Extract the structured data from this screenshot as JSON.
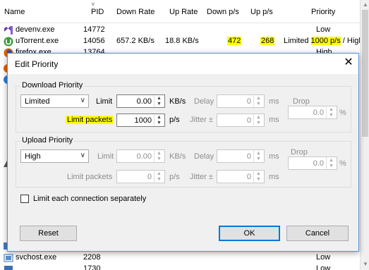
{
  "table": {
    "headers": {
      "name": "Name",
      "pid": "PID",
      "down_rate": "Down Rate",
      "up_rate": "Up Rate",
      "down_ps": "Down p/s",
      "up_ps": "Up p/s",
      "priority": "Priority"
    },
    "rows": [
      {
        "name": "devenv.exe",
        "pid": "14772",
        "priority": "Low"
      },
      {
        "name": "uTorrent.exe",
        "pid": "14056",
        "down_rate": "657.2 KB/s",
        "up_rate": "18.8 KB/s",
        "down_ps": "472",
        "up_ps": "268",
        "priority_prefix": "Limited",
        "priority_limit": "1000 p/s",
        "priority_sep": " / ",
        "priority_suffix": "High"
      },
      {
        "name": "firefox.exe",
        "pid": "13764",
        "priority": "High"
      }
    ],
    "bottom_rows": [
      {
        "name": "svchost.exe",
        "pid": "2208",
        "priority": "Low"
      },
      {
        "name": "",
        "pid": "1730",
        "priority": "Low"
      }
    ]
  },
  "dialog": {
    "title": "Edit Priority",
    "download": {
      "group_label": "Download Priority",
      "mode": "Limited",
      "limit_label": "Limit",
      "limit_value": "0.00",
      "limit_unit": "KB/s",
      "delay_label": "Delay",
      "delay_value": "0",
      "delay_unit": "ms",
      "drop_label": "Drop",
      "drop_value": "0.0",
      "drop_unit": "%",
      "packets_label": "Limit packets",
      "packets_value": "1000",
      "packets_unit": "p/s",
      "jitter_label": "Jitter ±",
      "jitter_value": "0",
      "jitter_unit": "ms"
    },
    "upload": {
      "group_label": "Upload Priority",
      "mode": "High",
      "limit_label": "Limit",
      "limit_value": "0.00",
      "limit_unit": "KB/s",
      "delay_label": "Delay",
      "delay_value": "0",
      "delay_unit": "ms",
      "drop_label": "Drop",
      "drop_value": "0.0",
      "drop_unit": "%",
      "packets_label": "Limit packets",
      "packets_value": "0",
      "packets_unit": "p/s",
      "jitter_label": "Jitter ±",
      "jitter_value": "0",
      "jitter_unit": "ms"
    },
    "separate_label": "Limit each connection separately",
    "reset_label": "Reset",
    "ok_label": "OK",
    "cancel_label": "Cancel"
  }
}
